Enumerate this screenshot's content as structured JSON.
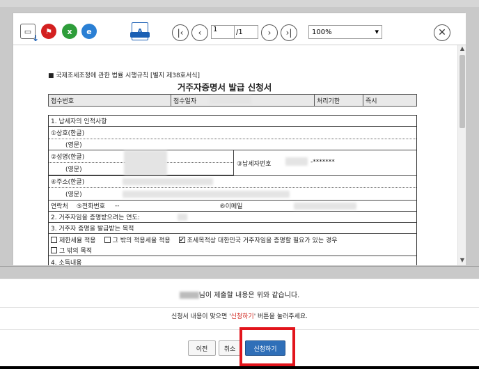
{
  "toolbar": {
    "page_current": "1",
    "page_total": "/1",
    "zoom": "100%",
    "print_label": "A"
  },
  "document": {
    "header": "■ 국제조세조정에 관한 법률 시행규칙 [별지 제38호서식]",
    "title": "거주자증명서 발급 신청서",
    "top_cells": [
      "접수번호",
      "접수일자",
      "처리기한",
      "즉시"
    ],
    "rows": [
      "1. 납세자의 인적사항",
      "①상호(한글)",
      "(영문)",
      "②성명(한글)",
      "(영문)",
      "③납세자번호",
      "-*******",
      "④주소(한글)",
      "(영문)",
      "연락처",
      "⑤전화번호",
      "--",
      "⑥이메일",
      "2. 거주자임을 증명받으려는 연도:",
      "3. 거주자 증명을 발급받는 목적",
      "제한세율 적용",
      "그 밖의 적용세율 적용",
      "조세목적상 대한민국 거주자임을 증명할 필요가 있는 경우",
      "그 밖의 목적",
      "4. 소득내용"
    ],
    "checked_mark": "✔"
  },
  "confirm": {
    "message": "님이 제출할 내용은 위와 같습니다.",
    "info_prefix": "신청서 내용이 맞으면 '",
    "info_accent": "신청하기",
    "info_suffix": "' 버튼을 눌러주세요.",
    "btn_prev": "이전",
    "btn_cancel": "취소",
    "btn_apply": "신청하기"
  }
}
